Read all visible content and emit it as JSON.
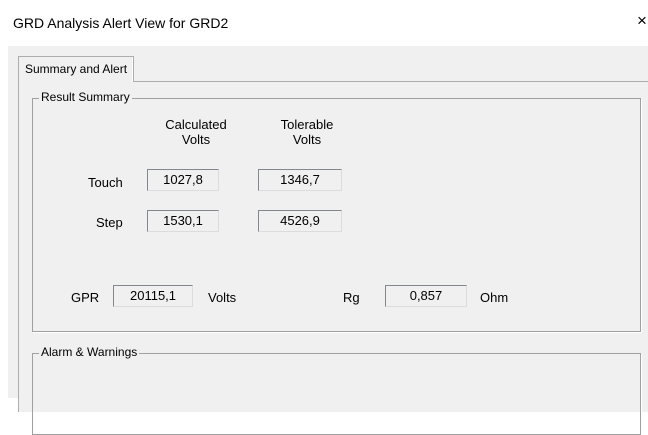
{
  "window": {
    "title": "GRD Analysis Alert View for GRD2",
    "close_glyph": "×"
  },
  "tabs": [
    {
      "label": "Summary and Alert",
      "selected": true
    }
  ],
  "result_summary": {
    "group_title": "Result Summary",
    "header_calculated": "Calculated\nVolts",
    "header_tolerable": "Tolerable\nVolts",
    "touch_label": "Touch",
    "touch_calculated": "1027,8",
    "touch_tolerable": "1346,7",
    "step_label": "Step",
    "step_calculated": "1530,1",
    "step_tolerable": "4526,9",
    "gpr_label": "GPR",
    "gpr_value": "20115,1",
    "gpr_unit": "Volts",
    "rg_label": "Rg",
    "rg_value": "0,857",
    "rg_unit": "Ohm"
  },
  "alarms": {
    "group_title": "Alarm & Warnings"
  }
}
